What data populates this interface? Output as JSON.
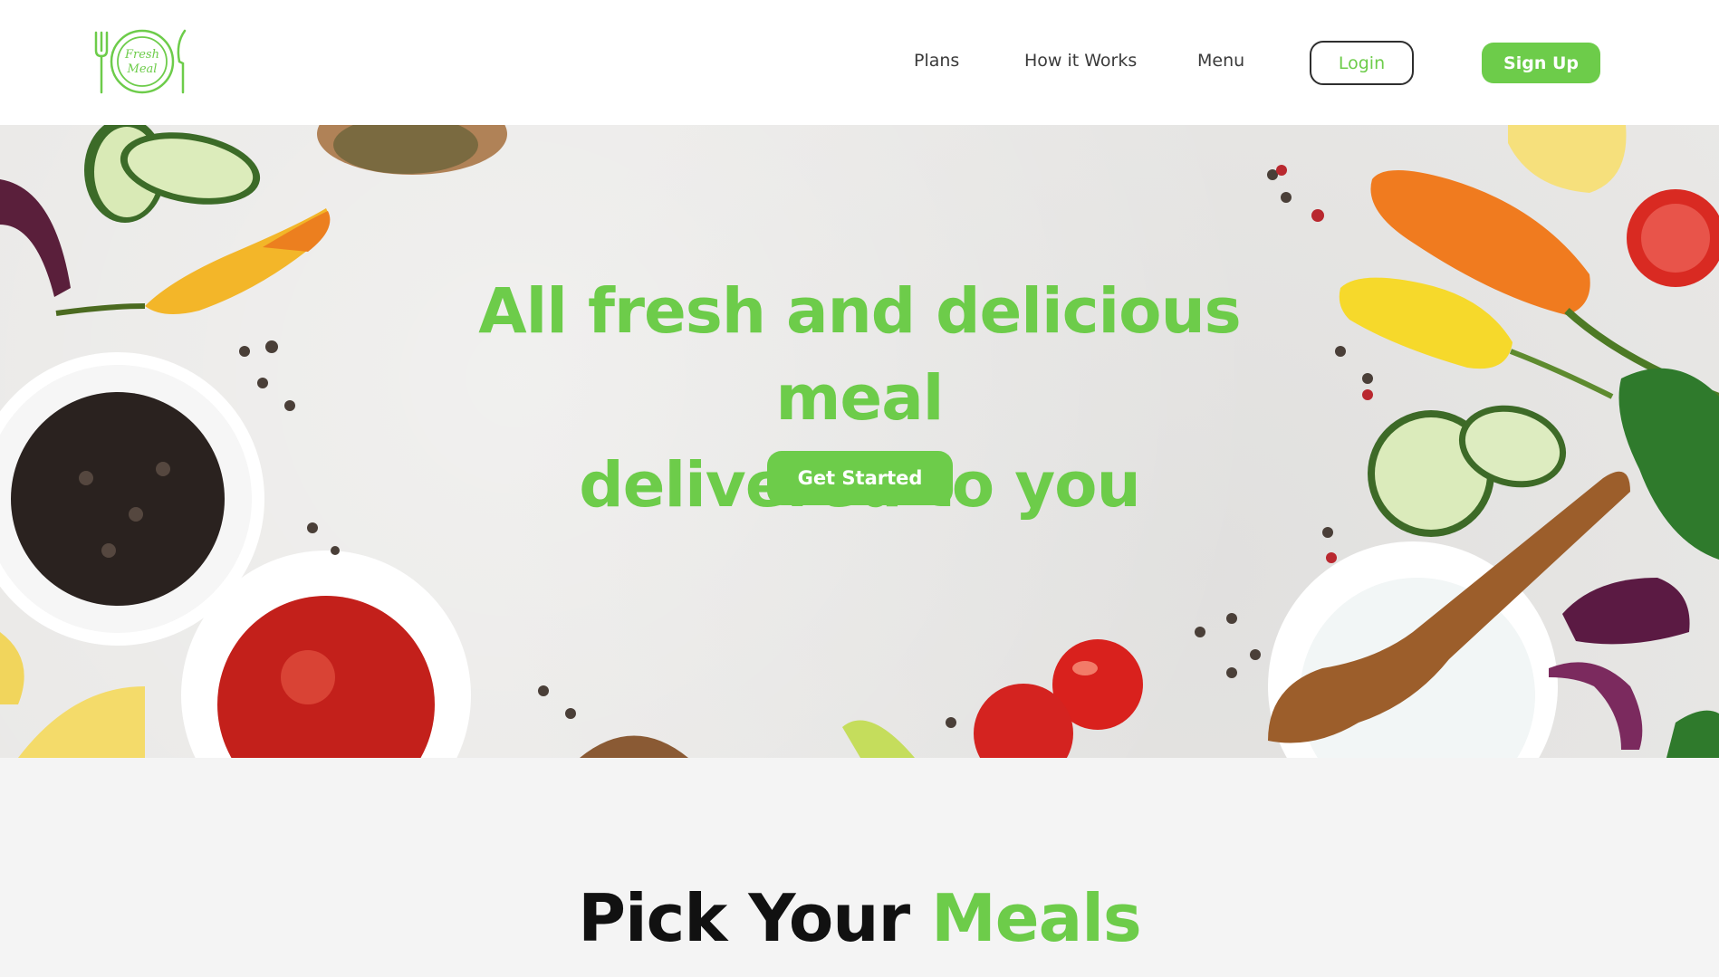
{
  "header": {
    "logo": {
      "line1": "Fresh",
      "line2": "Meal"
    },
    "nav": [
      "Plans",
      "How it Works",
      "Menu"
    ],
    "login_label": "Login",
    "signup_label": "Sign Up"
  },
  "hero": {
    "title_line1": "All fresh and delicious meal",
    "title_line2": "delivered to you",
    "cta_label": "Get Started"
  },
  "section": {
    "title_part1": "Pick Your ",
    "title_part2": "Meals"
  },
  "colors": {
    "brand_green": "#6dcc4a",
    "text_dark": "#111111",
    "page_bg": "#f4f4f4"
  }
}
